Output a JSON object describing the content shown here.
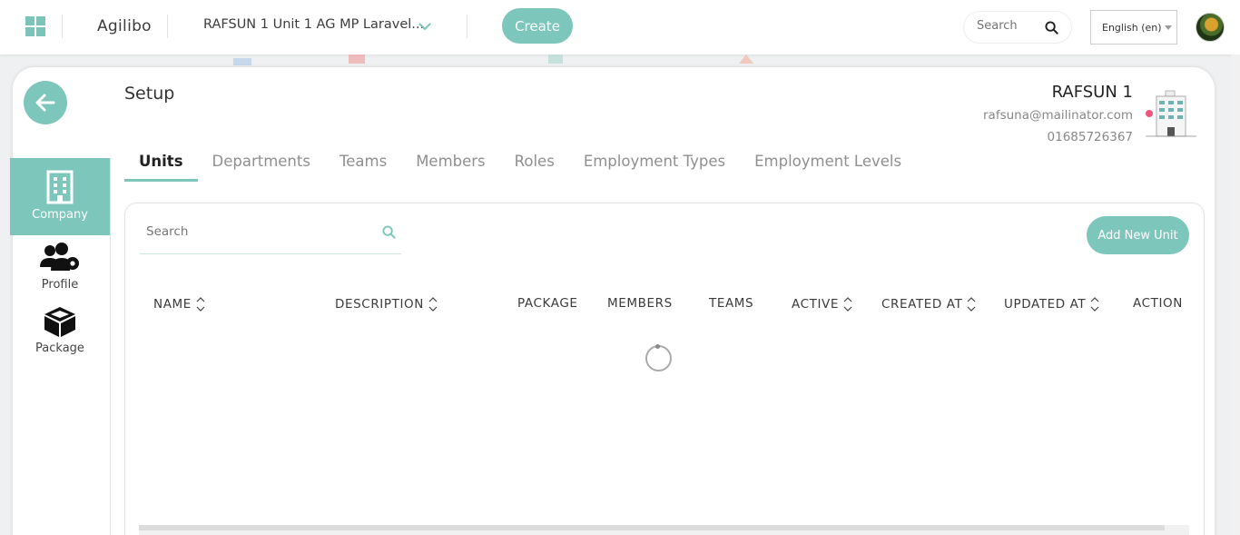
{
  "header": {
    "brand": "Agilibo",
    "context": "RAFSUN 1  Unit 1  AG MP Laravel...",
    "create_label": "Create",
    "search_placeholder": "Search",
    "language": "English (en)"
  },
  "sidebar": {
    "items": [
      {
        "label": "Company",
        "icon": "building-icon",
        "active": true
      },
      {
        "label": "Profile",
        "icon": "users-gear-icon",
        "active": false
      },
      {
        "label": "Package",
        "icon": "box-icon",
        "active": false
      }
    ]
  },
  "page": {
    "title": "Setup"
  },
  "company": {
    "name": "RAFSUN 1",
    "email": "rafsuna@mailinator.com",
    "phone": "01685726367"
  },
  "tabs": [
    {
      "label": "Units",
      "active": true
    },
    {
      "label": "Departments",
      "active": false
    },
    {
      "label": "Teams",
      "active": false
    },
    {
      "label": "Members",
      "active": false
    },
    {
      "label": "Roles",
      "active": false
    },
    {
      "label": "Employment Types",
      "active": false
    },
    {
      "label": "Employment Levels",
      "active": false
    }
  ],
  "table": {
    "search_placeholder": "Search",
    "add_label": "Add New Unit",
    "columns": [
      {
        "label": "NAME",
        "sortable": true
      },
      {
        "label": "DESCRIPTION",
        "sortable": true
      },
      {
        "label": "PACKAGE",
        "sortable": false
      },
      {
        "label": "MEMBERS",
        "sortable": false
      },
      {
        "label": "TEAMS",
        "sortable": false
      },
      {
        "label": "ACTIVE",
        "sortable": true
      },
      {
        "label": "CREATED AT",
        "sortable": true
      },
      {
        "label": "UPDATED AT",
        "sortable": true
      },
      {
        "label": "ACTION",
        "sortable": false
      }
    ],
    "loading": true
  },
  "colors": {
    "accent": "#7cc6bc",
    "text": "#333333",
    "muted": "#8f8f8f"
  }
}
